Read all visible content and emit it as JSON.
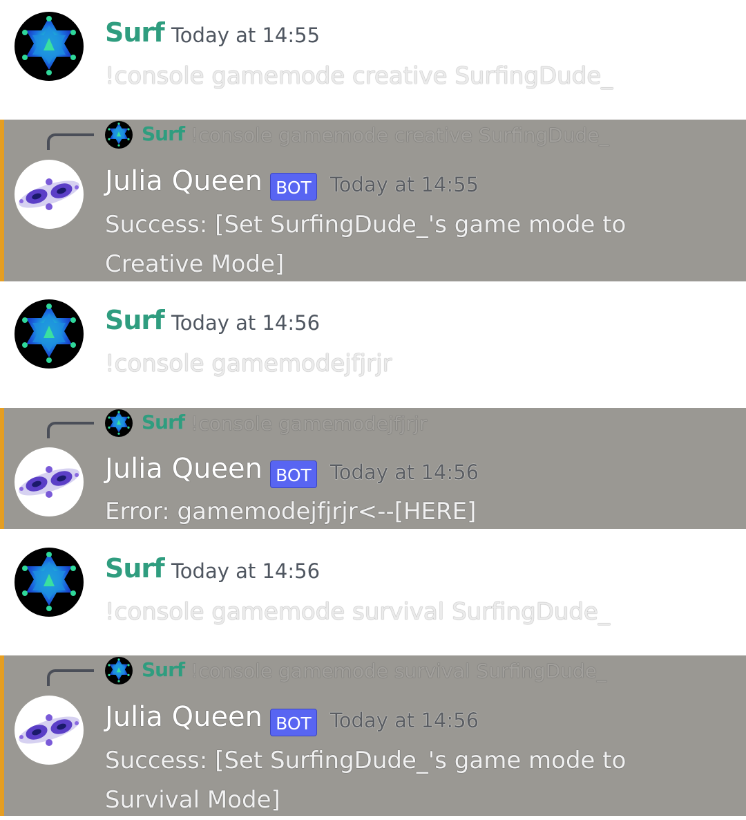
{
  "messages": [
    {
      "author": "Surf",
      "timestamp": "Today at 14:55",
      "content": "!console gamemode creative SurfingDude_"
    },
    {
      "reply_author": "Surf",
      "reply_text": "!console gamemode creative SurfingDude_",
      "author": "Julia Queen",
      "tag": "BOT",
      "timestamp": "Today at 14:55",
      "content": "Success: [Set SurfingDude_'s game mode to Creative Mode]"
    },
    {
      "author": "Surf",
      "timestamp": "Today at 14:56",
      "content": "!console gamemodejfjrjr"
    },
    {
      "reply_author": "Surf",
      "reply_text": "!console gamemodejfjrjr",
      "author": "Julia Queen",
      "tag": "BOT",
      "timestamp": "Today at 14:56",
      "content": "Error: gamemodejfjrjr<--[HERE]"
    },
    {
      "author": "Surf",
      "timestamp": "Today at 14:56",
      "content": "!console gamemode survival SurfingDude_"
    },
    {
      "reply_author": "Surf",
      "reply_text": "!console gamemode survival SurfingDude_",
      "author": "Julia Queen",
      "tag": "BOT",
      "timestamp": "Today at 14:56",
      "content": "Success: [Set SurfingDude_'s game mode to Survival Mode]"
    }
  ],
  "colors": {
    "surf_name": "#2f9d7f",
    "bot_tag": "#5865f2",
    "highlight_bg": "#9a9893",
    "highlight_bar": "#e59e22"
  }
}
